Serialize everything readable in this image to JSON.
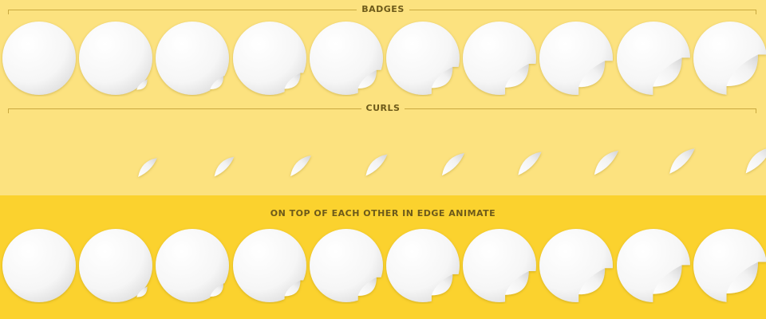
{
  "sections": {
    "badges_label": "BADGES",
    "curls_label": "CURLS",
    "stacked_label": "ON TOP OF EACH OTHER IN EDGE ANIMATE"
  },
  "badges": {
    "count": 10,
    "curl_levels": [
      0,
      0.12,
      0.2,
      0.28,
      0.36,
      0.44,
      0.52,
      0.6,
      0.68,
      0.76
    ]
  },
  "curls": {
    "count": 9,
    "curl_levels": [
      0.12,
      0.2,
      0.28,
      0.36,
      0.44,
      0.52,
      0.6,
      0.68,
      0.76
    ]
  },
  "stacked": {
    "count": 10,
    "curl_levels": [
      0,
      0.12,
      0.2,
      0.28,
      0.36,
      0.44,
      0.52,
      0.6,
      0.68,
      0.76
    ]
  },
  "colors": {
    "top_background": "#fce27f",
    "bottom_background": "#fbd22e",
    "label_text": "#6d5a1a",
    "rule": "#c9a940",
    "sticker_face": "#ffffff",
    "sticker_shade": "#e4e4e4"
  }
}
